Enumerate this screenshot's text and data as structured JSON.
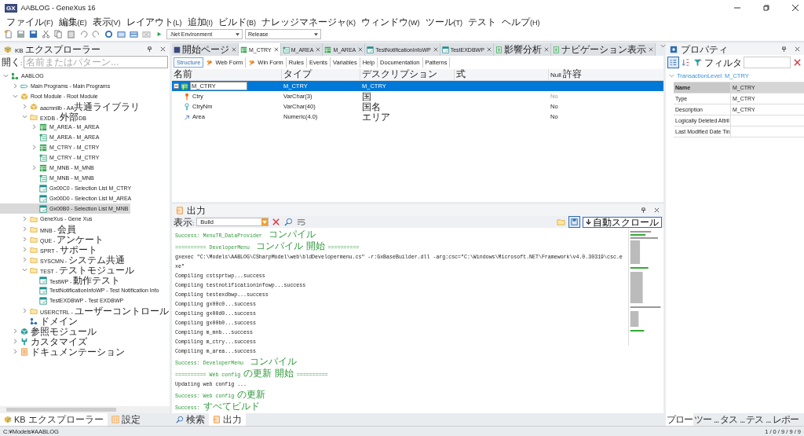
{
  "window": {
    "logo": "GX",
    "title": "AABLOG - GeneXus 16"
  },
  "menu": [
    "ファイル(F)",
    "編集(E)",
    "表示(V)",
    "レイアウト(L)",
    "追加(I)",
    "ビルド(B)",
    "ナレッジマネージャ(K)",
    "ウィンドウ(W)",
    "ツール(T)",
    "テスト",
    "ヘルプ(H)"
  ],
  "toolbar": {
    "environment": ".Net Environment",
    "configuration": "Release"
  },
  "kb_explorer": {
    "title": "KB エクスプローラー",
    "search": {
      "label": "開く:",
      "placeholder": "名前またはパターン..."
    },
    "tree": [
      {
        "label": "AABLOG",
        "kind": "kb",
        "expanded": true,
        "selected": false,
        "children": [
          {
            "label": "Main Programs - Main Programs",
            "kind": "mainprog",
            "expanded": false,
            "selected": false
          },
          {
            "label": "Root Module - Root Module",
            "kind": "module",
            "expanded": true,
            "selected": false,
            "children": [
              {
                "label": "aacmnlib - AA共通ライブラリ",
                "kind": "module",
                "expanded": false,
                "selected": false
              },
              {
                "label": "EXDB - 外部DB",
                "kind": "folder",
                "expanded": true,
                "selected": false,
                "children": [
                  {
                    "label": "M_AREA - M_AREA",
                    "kind": "transaction",
                    "expanded": false,
                    "selected": false
                  },
                  {
                    "label": "M_AREA - M_AREA",
                    "kind": "table",
                    "selected": false
                  },
                  {
                    "label": "M_CTRY - M_CTRY",
                    "kind": "transaction",
                    "expanded": false,
                    "selected": false
                  },
                  {
                    "label": "M_CTRY - M_CTRY",
                    "kind": "table",
                    "selected": false
                  },
                  {
                    "label": "M_MNB - M_MNB",
                    "kind": "transaction",
                    "expanded": false,
                    "selected": false
                  },
                  {
                    "label": "M_MNB - M_MNB",
                    "kind": "table",
                    "selected": false
                  },
                  {
                    "label": "Gx00C0 - Selection List M_CTRY",
                    "kind": "webpanel",
                    "selected": false
                  },
                  {
                    "label": "Gx00D0 - Selection List M_AREA",
                    "kind": "webpanel",
                    "selected": false
                  },
                  {
                    "label": "Gx00B0 - Selection List M_MNB",
                    "kind": "webpanel",
                    "selected": true
                  }
                ]
              },
              {
                "label": "GeneXus - Gene Xus",
                "kind": "folder",
                "expanded": false,
                "selected": false
              },
              {
                "label": "MNB - 会員",
                "kind": "folder",
                "expanded": false,
                "selected": false
              },
              {
                "label": "QUE - アンケート",
                "kind": "folder",
                "expanded": false,
                "selected": false
              },
              {
                "label": "SPRT - サポート",
                "kind": "folder",
                "expanded": false,
                "selected": false
              },
              {
                "label": "SYSCMN - システム共通",
                "kind": "folder",
                "expanded": false,
                "selected": false
              },
              {
                "label": "TEST - テストモジュール",
                "kind": "folder",
                "expanded": true,
                "selected": false,
                "children": [
                  {
                    "label": "TestWP - 動作テスト",
                    "kind": "webpanel",
                    "selected": false
                  },
                  {
                    "label": "TestNotificationInfoWP - Test Notification Info",
                    "kind": "webpanel",
                    "selected": false
                  },
                  {
                    "label": "TestEXDBWP - Test EXDBWP",
                    "kind": "webpanel",
                    "selected": false
                  }
                ]
              },
              {
                "label": "USERCTRL - ユーザーコントロール",
                "kind": "folder",
                "expanded": false,
                "selected": false
              },
              {
                "label": "ドメイン",
                "kind": "domain",
                "selected": false
              }
            ]
          },
          {
            "label": "参照モジュール",
            "kind": "refmodule",
            "expanded": false,
            "selected": false
          },
          {
            "label": "カスタマイズ",
            "kind": "customize",
            "expanded": false,
            "selected": false
          },
          {
            "label": "ドキュメンテーション",
            "kind": "doc",
            "expanded": false,
            "selected": false
          }
        ]
      }
    ],
    "bottom_tabs": [
      {
        "label": "KB エクスプローラー",
        "kind": "kb",
        "selected": true
      },
      {
        "label": "設定",
        "kind": "settings",
        "selected": false
      }
    ]
  },
  "editor_tabs": [
    {
      "label": "開始ページ",
      "kind": "start",
      "selected": false
    },
    {
      "label": "M_CTRY",
      "kind": "transaction",
      "selected": true
    },
    {
      "label": "M_AREA",
      "kind": "table",
      "selected": false
    },
    {
      "label": "M_AREA",
      "kind": "transaction",
      "selected": false
    },
    {
      "label": "TestNotificationInfoWP",
      "kind": "webpanel",
      "selected": false
    },
    {
      "label": "TestEXDBWP",
      "kind": "webpanel",
      "selected": false
    },
    {
      "label": "影響分析",
      "kind": "doc",
      "selected": false
    },
    {
      "label": "ナビゲーション表示",
      "kind": "doc",
      "selected": false
    }
  ],
  "sub_tabs": [
    {
      "label": "Structure",
      "kind": "plain",
      "selected": true
    },
    {
      "label": "Web Form",
      "kind": "form",
      "selected": false
    },
    {
      "label": "Win Form",
      "kind": "form",
      "selected": false
    },
    {
      "label": "Rules",
      "kind": "plain",
      "selected": false
    },
    {
      "label": "Events",
      "kind": "plain",
      "selected": false
    },
    {
      "label": "Variables",
      "kind": "plain",
      "selected": false
    },
    {
      "label": "Help",
      "kind": "plain",
      "selected": false
    },
    {
      "label": "Documentation",
      "kind": "plain",
      "selected": false
    },
    {
      "label": "Patterns",
      "kind": "plain",
      "selected": false
    }
  ],
  "structure": {
    "columns": [
      "名前",
      "タイプ",
      "デスクリプション",
      "式",
      "Null 許容"
    ],
    "rows": [
      {
        "name": "M_CTRY",
        "type": "M_CTRY",
        "description": "M_CTRY",
        "kind": "level",
        "expanded": true,
        "selected": true,
        "children": [
          {
            "name": "Ctry",
            "type": "VarChar(3)",
            "description": "国",
            "nullable": "No",
            "null_disabled": true,
            "kind": "key",
            "selected": false
          },
          {
            "name": "CtryNm",
            "type": "VarChar(40)",
            "description": "国名",
            "nullable": "No",
            "null_disabled": false,
            "kind": "description",
            "selected": false
          },
          {
            "name": "Area",
            "type": "Numeric(4.0)",
            "description": "エリア",
            "nullable": "No",
            "null_disabled": false,
            "kind": "attribute",
            "selected": false
          }
        ]
      }
    ]
  },
  "output": {
    "title": "出力",
    "show_label": "表示:",
    "show_value": "Build",
    "auto_scroll": "自動スクロール",
    "lines": [
      {
        "kind": "info",
        "text": "Success: MenuTR_DataProvider  コンパイル"
      },
      {
        "kind": "info",
        "text": "========== DeveloperMenu  コンパイル 開始 =========="
      },
      {
        "kind": "plain",
        "text": "gxexec \"C:\\Models\\AABLOG\\CSharpModel\\web\\bldDevelopermenu.cs\" -r:GxBaseBuilder.dll -arg:csc=\"C:\\Windows\\Microsoft.NET\\Framework\\v4.0.30319\\csc.exe\""
      },
      {
        "kind": "plain",
        "text": "Compiling cstsprtwp...success"
      },
      {
        "kind": "plain",
        "text": "Compiling testnotificationinfowp...success"
      },
      {
        "kind": "plain",
        "text": "Compiling testexdbwp...success"
      },
      {
        "kind": "plain",
        "text": "Compiling gx00c0...success"
      },
      {
        "kind": "plain",
        "text": "Compiling gx00d0...success"
      },
      {
        "kind": "plain",
        "text": "Compiling gx00b0...success"
      },
      {
        "kind": "plain",
        "text": "Compiling m_mnb...success"
      },
      {
        "kind": "plain",
        "text": "Compiling m_ctry...success"
      },
      {
        "kind": "plain",
        "text": "Compiling m_area...success"
      },
      {
        "kind": "info",
        "text": "Success: DeveloperMenu  コンパイル"
      },
      {
        "kind": "info",
        "text": "========== Web config の更新 開始 =========="
      },
      {
        "kind": "plain",
        "text": "Updating web config ..."
      },
      {
        "kind": "info",
        "text": "Success: Web config の更新"
      },
      {
        "kind": "info",
        "text": "Success: すべてビルド"
      }
    ],
    "bottom_tabs": [
      {
        "label": "検索",
        "kind": "search",
        "selected": false
      },
      {
        "label": "出力",
        "kind": "output",
        "selected": true
      }
    ]
  },
  "properties": {
    "title": "プロパティ",
    "filter_label": "フィルタ",
    "group": {
      "label": "TransactionLevel: M_CTRY",
      "expanded": true
    },
    "rows": [
      {
        "name": "Name",
        "value": "M_CTRY",
        "selected": true
      },
      {
        "name": "Type",
        "value": "M_CTRY",
        "selected": false
      },
      {
        "name": "Description",
        "value": "M_CTRY",
        "selected": false
      },
      {
        "name": "Logically Deleted Attril",
        "selected": false
      },
      {
        "name": "Last Modified Date Tin",
        "selected": false
      }
    ],
    "bottom_tabs": [
      {
        "label": "プロー",
        "selected": true
      },
      {
        "label": "ツー...",
        "selected": false
      },
      {
        "label": "タス...",
        "selected": false
      },
      {
        "label": "テス...",
        "selected": false
      },
      {
        "label": "レポー",
        "selected": false
      }
    ]
  },
  "status_bar": {
    "path": "C:¥Models¥AABLOG",
    "counts": "1 / 0 / 9 / 9 / 9"
  }
}
